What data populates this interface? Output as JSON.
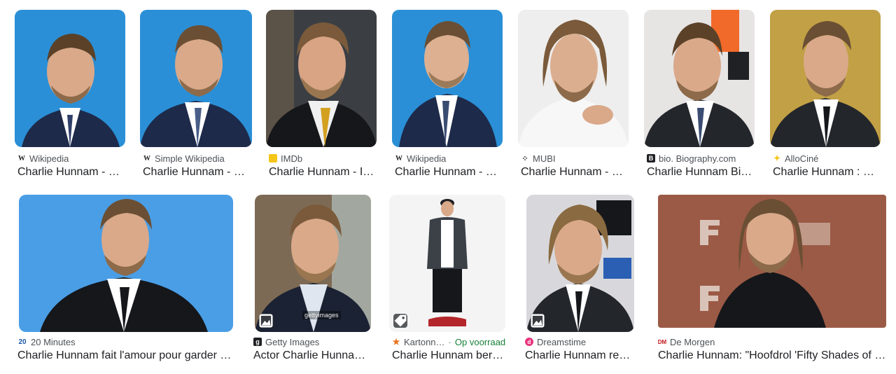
{
  "colors": {
    "text_primary": "#202124",
    "text_secondary": "#4d5156",
    "in_stock_green": "#188038"
  },
  "results": [
    {
      "source": "Wikipedia",
      "title": "Charlie Hunnam - W…",
      "favicon": "wikipedia-icon",
      "bg": "#2a8fd6"
    },
    {
      "source": "Simple Wikipedia",
      "title": "Charlie Hunnam - Si…",
      "favicon": "wikipedia-icon",
      "bg": "#2a8fd6"
    },
    {
      "source": "IMDb",
      "title": "Charlie Hunnam - I…",
      "favicon": "imdb-icon",
      "bg": "#3b3f44"
    },
    {
      "source": "Wikipedia",
      "title": "Charlie Hunnam - W…",
      "favicon": "wikipedia-icon",
      "bg": "#2a8fd6"
    },
    {
      "source": "MUBI",
      "title": "Charlie Hunnam - Fi…",
      "favicon": "mubi-icon",
      "bg": "#eeeeee"
    },
    {
      "source": "bio. Biography.com",
      "title": "Charlie Hunnam Bio…",
      "favicon": "biography-icon",
      "bg": "#e7e4e4"
    },
    {
      "source": "AlloCiné",
      "title": "Charlie Hunnam : S…",
      "favicon": "allocine-icon",
      "bg": "#c8a74a"
    },
    {
      "source": "20 Minutes",
      "title": "Charlie Hunnam fait l'amour pour garder la…",
      "favicon": "20minutes-icon",
      "bg": "#4a9ee6"
    },
    {
      "source": "Getty Images",
      "title": "Actor Charlie Hunnam…",
      "favicon": "getty-icon",
      "bg": "#7d6a55",
      "watermark": "gettyimages"
    },
    {
      "source": "Kartonn…",
      "extra": "Op voorraad",
      "title": "Charlie Hunnam bero…",
      "favicon": "kartonnen-icon",
      "bg": "#f4f4f4"
    },
    {
      "source": "Dreamstime",
      "title": "Charlie Hunnam reda…",
      "favicon": "dreamstime-icon",
      "bg": "#d8d8dc"
    },
    {
      "source": "De Morgen",
      "title": "Charlie Hunnam: \"Hoofdrol 'Fifty Shades of G…",
      "favicon": "demorgen-icon",
      "bg": "#9b5a45"
    }
  ]
}
